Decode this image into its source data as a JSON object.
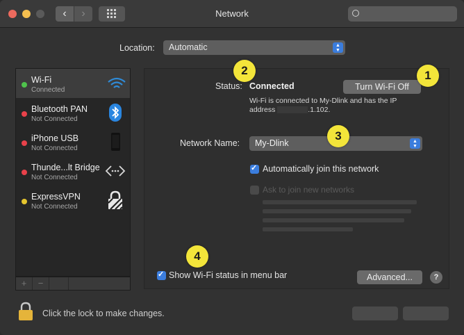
{
  "window": {
    "title": "Network"
  },
  "toolbar": {
    "back_icon": "‹",
    "forward_icon": "›"
  },
  "location": {
    "label": "Location:",
    "value": "Automatic"
  },
  "services": [
    {
      "name": "Wi-Fi",
      "status": "Connected",
      "dot": "green",
      "icon": "wifi-icon"
    },
    {
      "name": "Bluetooth PAN",
      "status": "Not Connected",
      "dot": "red",
      "icon": "bluetooth-icon"
    },
    {
      "name": "iPhone USB",
      "status": "Not Connected",
      "dot": "red",
      "icon": "iphone-icon"
    },
    {
      "name": "Thunde...lt Bridge",
      "status": "Not Connected",
      "dot": "red",
      "icon": "thunderbolt-bridge-icon"
    },
    {
      "name": "ExpressVPN",
      "status": "Not Connected",
      "dot": "yellow",
      "icon": "vpn-lock-icon"
    }
  ],
  "sidebar_footer": {
    "add": "+",
    "remove": "−"
  },
  "status": {
    "label": "Status:",
    "value": "Connected",
    "toggle_button": "Turn Wi-Fi Off",
    "description_prefix": "Wi-Fi is connected to My-Dlink and has the IP address",
    "description_suffix": ".1.102."
  },
  "network_name": {
    "label": "Network Name:",
    "value": "My-Dlink"
  },
  "auto_join": {
    "label": "Automatically join this network",
    "checked": true
  },
  "ask_new": {
    "label": "Ask to join new networks",
    "checked": false
  },
  "show_status": {
    "label": "Show Wi-Fi status in menu bar",
    "checked": true
  },
  "buttons": {
    "advanced": "Advanced...",
    "help": "?"
  },
  "bottom": {
    "lock_text": "Click the lock to make changes."
  },
  "callouts": [
    "1",
    "2",
    "3",
    "4"
  ],
  "colors": {
    "accent": "#3b7ddd",
    "callout": "#f3e53a",
    "connected": "#4fc34c",
    "disconnected": "#e9414a",
    "vpn": "#e5c52e"
  }
}
